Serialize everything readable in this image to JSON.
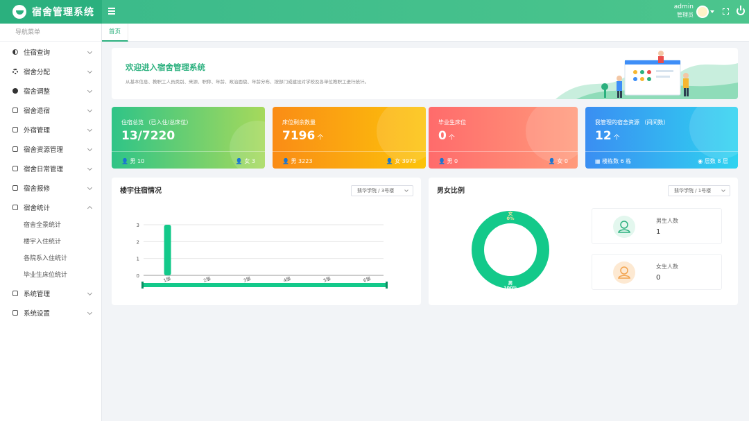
{
  "app": {
    "title": "宿舍管理系统"
  },
  "header": {
    "user_name": "admin",
    "user_role": "管理员"
  },
  "sidebar": {
    "heading": "导航菜单",
    "items": [
      {
        "label": "住宿查询",
        "icon": "halfmoon-icon"
      },
      {
        "label": "宿舍分配",
        "icon": "gear-icon"
      },
      {
        "label": "宿舍调整",
        "icon": "info-icon"
      },
      {
        "label": "宿舍退宿",
        "icon": "home-icon"
      },
      {
        "label": "外宿管理",
        "icon": "home-icon"
      },
      {
        "label": "宿舍资源管理",
        "icon": "home-icon"
      },
      {
        "label": "宿舍日常管理",
        "icon": "home-icon"
      },
      {
        "label": "宿舍报修",
        "icon": "home-icon"
      },
      {
        "label": "宿舍统计",
        "icon": "home-icon",
        "expanded": true
      },
      {
        "label": "系统管理",
        "icon": "home-icon"
      },
      {
        "label": "系统设置",
        "icon": "home-icon"
      }
    ],
    "sub_items": [
      "宿舍全景统计",
      "楼宇入住统计",
      "各院系入住统计",
      "毕业生床位统计"
    ]
  },
  "tabs": [
    {
      "label": "首页",
      "active": true
    }
  ],
  "welcome": {
    "title": "欢迎进入宿舍管理系统",
    "desc": "从基本信息、教职工人员类别、来源、职称、年龄、政治面貌、年龄分布、按部门或建设对学校及各单位教职工进行统计。"
  },
  "cards": [
    {
      "label": "住宿总览 （已入住/总床位）",
      "value": "13/7220",
      "unit": "",
      "foot_left": "男 10",
      "foot_right": "女 3",
      "color_from": "#2fc487",
      "color_to": "#a6d95b"
    },
    {
      "label": "床位剩余数量",
      "value": "7196",
      "unit": "个",
      "foot_left": "男 3223",
      "foot_right": "女 3973",
      "color_from": "#fa8c16",
      "color_to": "#fcc30a"
    },
    {
      "label": "毕业生床位",
      "value": "0",
      "unit": "个",
      "foot_left": "男 0",
      "foot_right": "女 0",
      "color_from": "#ff6b6b",
      "color_to": "#ff9a7b"
    },
    {
      "label": "我管理的宿舍资源 （间间数）",
      "value": "12",
      "unit": "个",
      "foot_left": "楼栋数 6 栋",
      "foot_right": "层数 8 层",
      "color_from": "#3a8ef2",
      "color_to": "#2fd3f0"
    }
  ],
  "panels": {
    "occupancy": {
      "title": "楼宇住宿情况",
      "select": "翡华学院 / 3号楼"
    },
    "gender": {
      "title": "男女比例",
      "select": "翡华学院 / 1号楼",
      "male_label": "男生人数",
      "male_value": "1",
      "female_label": "女生人数",
      "female_value": "0"
    }
  },
  "chart_data": [
    {
      "type": "bar",
      "categories": [
        "1层",
        "2层",
        "3层",
        "4层",
        "5层",
        "6层"
      ],
      "values": [
        3,
        0,
        0,
        0,
        0,
        0
      ],
      "title": "",
      "ylim": [
        0,
        3
      ],
      "yticks": [
        0,
        1,
        2,
        3
      ],
      "grid": true,
      "color": "#13c98a",
      "dataZoom": true
    },
    {
      "type": "pie",
      "labels": [
        "女",
        "男"
      ],
      "slice_labels": [
        "女\n0%",
        "男\n100%"
      ],
      "values": [
        0,
        100
      ],
      "colors": [
        "#f2b25c",
        "#13c98a"
      ],
      "donut": true
    }
  ]
}
